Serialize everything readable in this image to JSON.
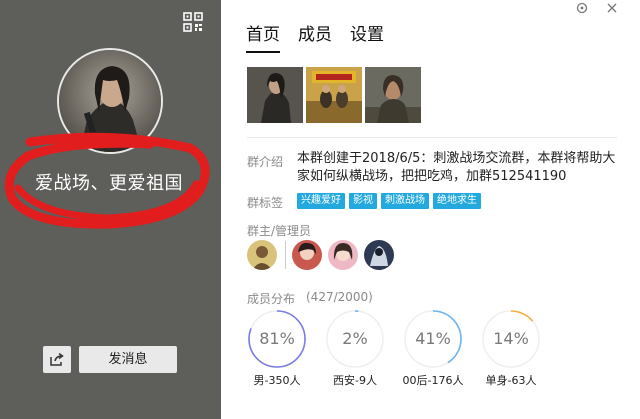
{
  "left": {
    "group_name": "爱战场、更爱祖国",
    "send_button": "发消息",
    "icons": {
      "qr": "qr-code-icon",
      "share": "share-icon"
    }
  },
  "window": {
    "controls": [
      "menu-icon",
      "close-icon"
    ]
  },
  "tabs": [
    {
      "label": "首页",
      "active": true
    },
    {
      "label": "成员",
      "active": false
    },
    {
      "label": "设置",
      "active": false
    }
  ],
  "intro": {
    "label": "群介绍",
    "text": "本群创建于2018/6/5：刺激战场交流群，本群将帮助大家如何纵横战场，把把吃鸡，加群512541190"
  },
  "tags": {
    "label": "群标签",
    "items": [
      "兴趣爱好",
      "影视",
      "刺激战场",
      "绝地求生"
    ],
    "color": "#23a9de"
  },
  "admins": {
    "label": "群主/管理员"
  },
  "distribution": {
    "label": "成员分布",
    "count": "(427/2000)",
    "stats": [
      {
        "pct": "81%",
        "value": 0.81,
        "label": "男-350人",
        "color": "#7b7de6"
      },
      {
        "pct": "2%",
        "value": 0.02,
        "label": "西安-9人",
        "color": "#6db4f0"
      },
      {
        "pct": "41%",
        "value": 0.41,
        "label": "00后-176人",
        "color": "#6db4f0"
      },
      {
        "pct": "14%",
        "value": 0.14,
        "label": "单身-63人",
        "color": "#f5b040"
      }
    ]
  }
}
